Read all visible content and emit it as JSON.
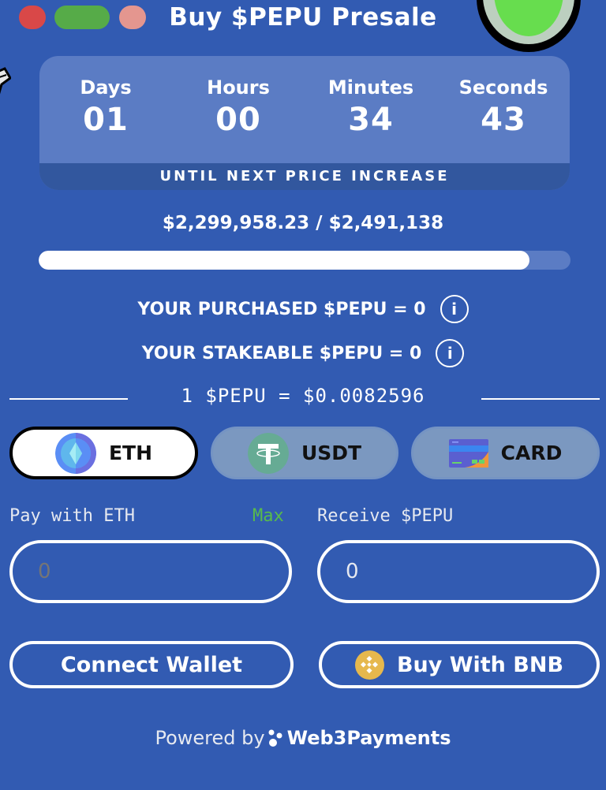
{
  "header": {
    "title": "Buy $PEPU Presale",
    "window_dots": [
      "red",
      "green",
      "pink"
    ]
  },
  "countdown": {
    "units": [
      {
        "label": "Days",
        "value": "01"
      },
      {
        "label": "Hours",
        "value": "00"
      },
      {
        "label": "Minutes",
        "value": "34"
      },
      {
        "label": "Seconds",
        "value": "43"
      }
    ],
    "footer": "UNTIL NEXT PRICE INCREASE"
  },
  "raise": {
    "text": "$2,299,958.23 / $2,491,138",
    "raised": 2299958.23,
    "goal": 2491138,
    "progress_fraction": 0.923
  },
  "stats": {
    "purchased": "YOUR PURCHASED $PEPU = 0",
    "stakeable": "YOUR STAKEABLE $PEPU = 0",
    "info_icon": "i"
  },
  "rate": {
    "text": "1 $PEPU = $0.0082596"
  },
  "payment_methods": [
    {
      "label": "ETH",
      "icon": "eth-icon",
      "active": true
    },
    {
      "label": "USDT",
      "icon": "tether-icon",
      "active": false
    },
    {
      "label": "CARD",
      "icon": "credit-card-icon",
      "active": false
    }
  ],
  "pay_field": {
    "label": "Pay with ETH",
    "max_label": "Max",
    "placeholder": "0",
    "value": ""
  },
  "receive_field": {
    "label": "Receive $PEPU",
    "value": "0"
  },
  "buttons": {
    "connect_wallet": "Connect Wallet",
    "buy_bnb": "Buy With BNB"
  },
  "footer": {
    "powered_by": "Powered by",
    "brand": "Web3Payments"
  },
  "colors": {
    "background": "#325bb2",
    "panel": "#5b7cc4",
    "panel_footer": "#32579e",
    "max_green": "#58bb4b",
    "bnb_gold": "#e6b84d"
  }
}
